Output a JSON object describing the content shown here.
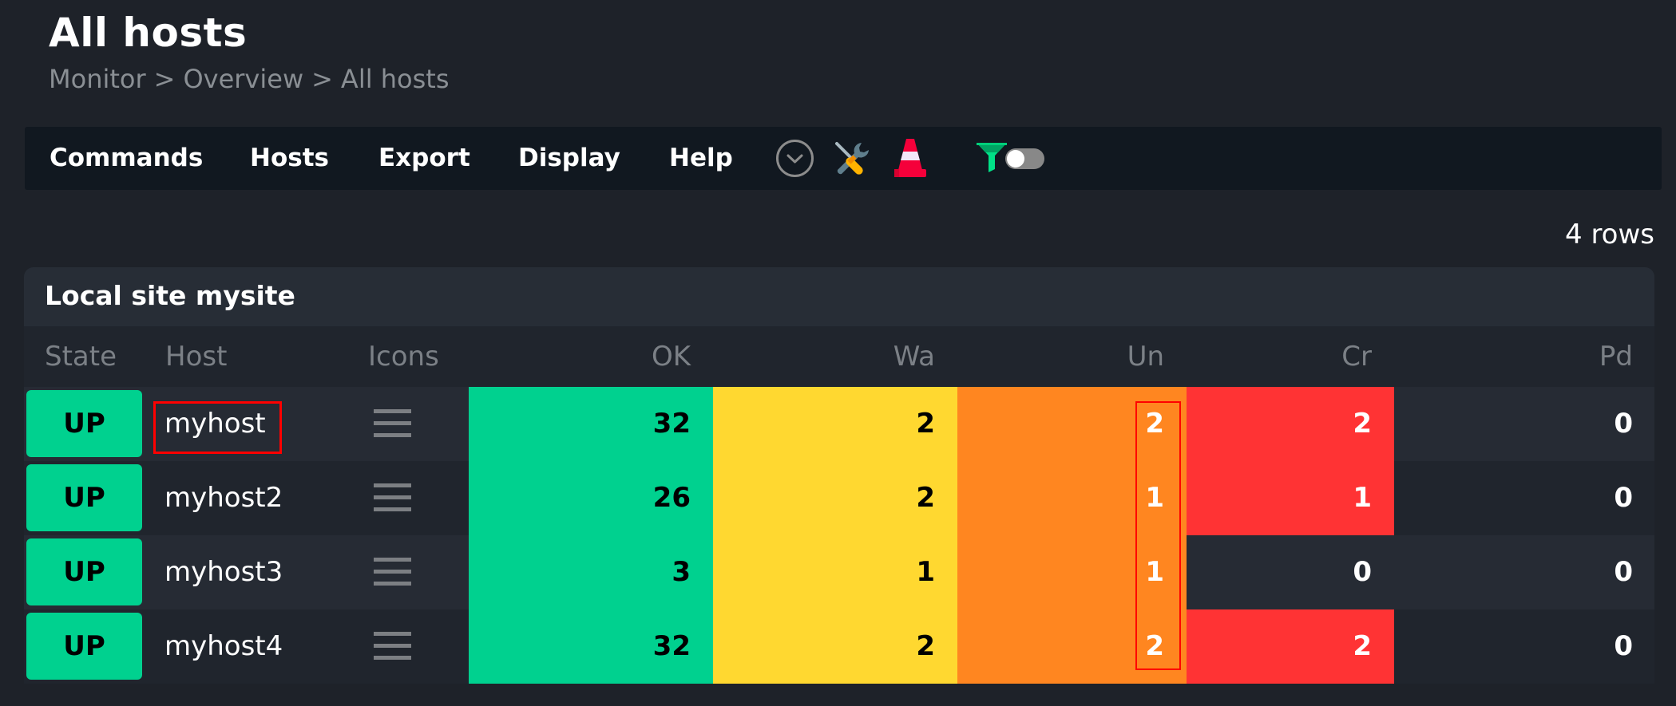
{
  "page": {
    "title": "All hosts",
    "breadcrumb": [
      "Monitor",
      "Overview",
      "All hosts"
    ],
    "breadcrumb_separator": ">"
  },
  "toolbar": {
    "menus": [
      "Commands",
      "Hosts",
      "Export",
      "Display",
      "Help"
    ],
    "icons": [
      "chevron-down-circle-icon",
      "wrench-screwdriver-icon",
      "traffic-cone-icon",
      "filter-funnel-icon",
      "toggle-switch-icon"
    ],
    "toggle_state": "off"
  },
  "rows_count_label": "4 rows",
  "table": {
    "site_title": "Local site mysite",
    "columns": [
      "State",
      "Host",
      "Icons",
      "OK",
      "Wa",
      "Un",
      "Cr",
      "Pd"
    ],
    "colors": {
      "up": "#00d18f",
      "ok": "#00d18f",
      "warn": "#ffd830",
      "unknown": "#ff8620",
      "crit": "#ff3334",
      "highlight_border": "#ff0000"
    },
    "rows": [
      {
        "state": "UP",
        "host": "myhost",
        "ok": "32",
        "wa": "2",
        "un": "2",
        "cr": "2",
        "pd": "0"
      },
      {
        "state": "UP",
        "host": "myhost2",
        "ok": "26",
        "wa": "2",
        "un": "1",
        "cr": "1",
        "pd": "0"
      },
      {
        "state": "UP",
        "host": "myhost3",
        "ok": "3",
        "wa": "1",
        "un": "1",
        "cr": "0",
        "pd": "0"
      },
      {
        "state": "UP",
        "host": "myhost4",
        "ok": "32",
        "wa": "2",
        "un": "2",
        "cr": "2",
        "pd": "0"
      }
    ]
  }
}
